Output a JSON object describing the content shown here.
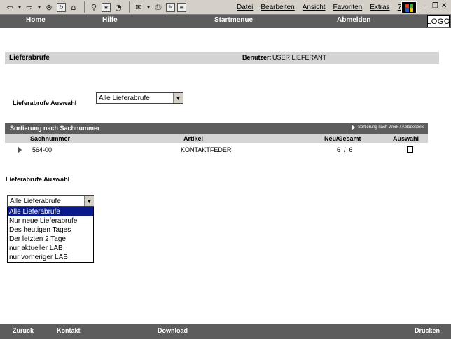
{
  "browser": {
    "menu": [
      "Datei",
      "Bearbeiten",
      "Ansicht",
      "Favoriten",
      "Extras",
      "?"
    ],
    "icons": [
      "back-icon",
      "forward-icon",
      "stop-icon",
      "refresh-icon",
      "home-icon",
      "search-icon",
      "favorites-icon",
      "history-icon",
      "mail-icon",
      "print-icon",
      "edit-icon",
      "discuss-icon"
    ],
    "window_controls": [
      "minimize",
      "maximize",
      "close"
    ]
  },
  "nav": {
    "home": "Home",
    "hilfe": "Hilfe",
    "startmenue": "Startmenue",
    "abmelden": "Abmelden",
    "logo": "LOGO"
  },
  "page": {
    "title": "Lieferabrufe",
    "user_label": "Benutzer:",
    "user_name": "USER LIEFERANT"
  },
  "filter_top": {
    "label": "Lieferabrufe Auswahl",
    "selected": "Alle Lieferabrufe"
  },
  "table": {
    "title": "Sortierung nach Sachnummer",
    "sort_link": "Sortierung nach Werk / Abladestelle",
    "columns": [
      "Sachnummer",
      "Artikel",
      "Neu/Gesamt",
      "Auswahl"
    ],
    "rows": [
      {
        "sachnummer": "564-00",
        "artikel": "KONTAKTFEDER",
        "neu_gesamt": "6  /  6",
        "auswahl": false
      }
    ]
  },
  "filter_bottom": {
    "label": "Lieferabrufe Auswahl",
    "selected": "Alle Lieferabrufe",
    "options": [
      "Alle Lieferabrufe",
      "Nur neue Lieferabrufe",
      "Des heutigen Tages",
      "Der letzten 2 Tage",
      "nur aktueller LAB",
      "nur vorheriger LAB"
    ]
  },
  "footer": {
    "zurueck": "Zuruck",
    "kontakt": "Kontakt",
    "download": "Download",
    "drucken": "Drucken"
  }
}
